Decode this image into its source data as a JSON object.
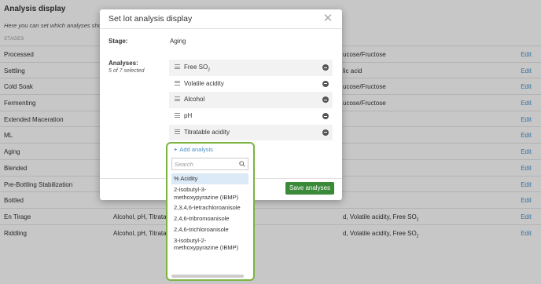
{
  "page": {
    "title": "Analysis display",
    "subtitle": "Here you can set which analyses show",
    "column_header": "STAGES",
    "rows": [
      {
        "stage": "Processed",
        "analyses": "",
        "right": "ucose/Fructose",
        "edit": "Edit"
      },
      {
        "stage": "Settling",
        "analyses": "",
        "right": "lic acid",
        "edit": "Edit"
      },
      {
        "stage": "Cold Soak",
        "analyses": "",
        "right": "ucose/Fructose",
        "edit": "Edit"
      },
      {
        "stage": "Fermenting",
        "analyses": "",
        "right": "ucose/Fructose",
        "edit": "Edit"
      },
      {
        "stage": "Extended Maceration",
        "analyses": "",
        "right": "",
        "edit": "Edit"
      },
      {
        "stage": "ML",
        "analyses": "",
        "right": "",
        "edit": "Edit"
      },
      {
        "stage": "Aging",
        "analyses": "",
        "right": "",
        "edit": "Edit"
      },
      {
        "stage": "Blended",
        "analyses": "",
        "right": "",
        "edit": "Edit"
      },
      {
        "stage": "Pre-Bottling Stabilization",
        "analyses": "",
        "right": "",
        "edit": "Edit"
      },
      {
        "stage": "Bottled",
        "analyses": "",
        "right": "",
        "edit": "Edit"
      },
      {
        "stage": "En Tirage",
        "analyses": "Alcohol, pH, Titratab",
        "right": "d, Volatile acidity, Free SO",
        "edit": "Edit"
      },
      {
        "stage": "Riddling",
        "analyses": "Alcohol, pH, Titratab",
        "right": "d, Volatile acidity, Free SO",
        "edit": "Edit"
      }
    ]
  },
  "modal": {
    "title": "Set lot analysis display",
    "stage_label": "Stage:",
    "stage_value": "Aging",
    "analyses_label": "Analyses:",
    "analyses_count": "5 of 7 selected",
    "selected": [
      "Free SO",
      "Volatile acidity",
      "Alcohol",
      "pH",
      "Titratable acidity"
    ],
    "add_label": "Add analysis",
    "search_placeholder": "Search",
    "options": [
      "% Acidity",
      "2-isobutyl-3-methoxypyrazine (IBMP)",
      "2,3,4,6-tetrachloroanisole",
      "2,4,6-tribromoanisole",
      "2,4,6-trichloroanisole",
      "3-isobutyl-2-methoxypyrazine (IBMP)"
    ],
    "save_label": "Save analyses",
    "close_icon": "close-icon"
  },
  "colors": {
    "accent_blue": "#4a8fc9",
    "save_green": "#3a8a3a",
    "dropdown_border": "#7cb342"
  }
}
